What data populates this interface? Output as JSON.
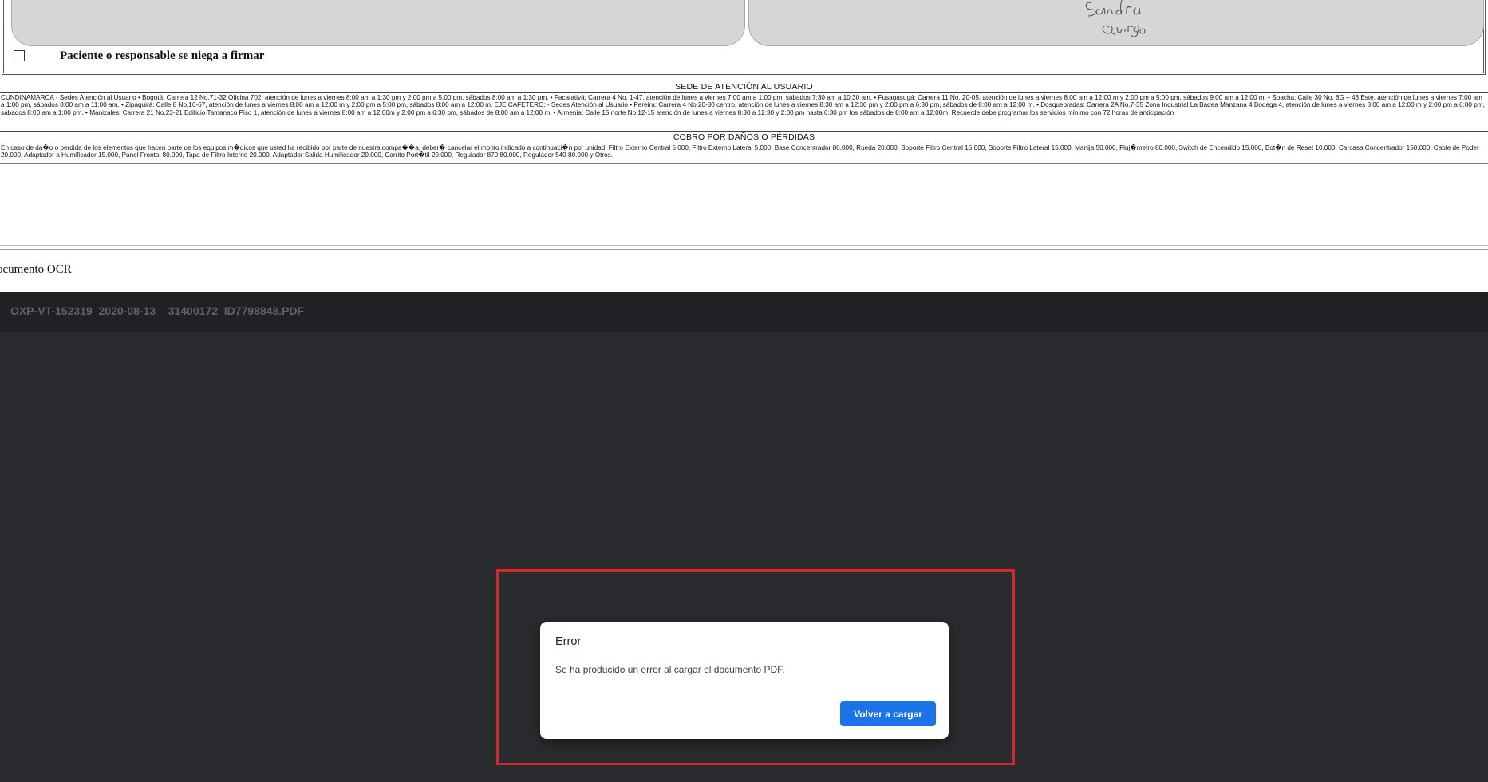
{
  "document": {
    "refuse_to_sign_label": "Paciente o responsable se niega a firmar",
    "signature_text": "Sandra Quiroga",
    "section_user_service": {
      "heading": "SEDE DE ATENCIÓN AL USUARIO",
      "text": "CUNDINAMARCA - Sedes Atención al Usuario • Bogotá: Carrera 12 No.71-32 Oficina 702, atención de lunes a viernes 8:00 am a 1:30 pm y 2:00 pm a 5:00 pm, sábados 8:00 am a 1:30 pm. • Facatativá: Carrera 4 No. 1-47, atención de lunes a viernes 7:00 am a 1:00 pm, sábados 7:30 am a 10:30 am. • Fusagasugá: Carrera 11 No. 20-05, atención de lunes a viernes 8:00 am a 12:00 m y 2:00 pm a 5:00 pm, sábados 9:00 am a 12:00 m. • Soacha: Calle 30 No. 6G – 43 Este, atención de lunes a viernes 7:00 am a 1:00 pm, sábados 8:00 am a 11:00 am. • Zipaquirá: Calle 8 No.16-67, atención de lunes a viernes 8:00 am a 12:00 m y 2:00 pm a 5:00 pm, sábados 8:00 am a 12:00 m. EJE CAFETERO: - Sedes Atención al Usuario • Pereira: Carrera 4 No.20-80 centro, atención de lunes a viernes 8:30 am a 12:30 pm y 2:00 pm a 6:30 pm, sábados de 8:00 am a 12:00 m. • Dosquebradas: Carrera 2A No.7-35 Zona Industrial La Badea Manzana 4 Bodega 4, atención de lunes a viernes 8:00 am a 12:00 m y 2:00 pm a 6:00 pm, sábados 8:00 am a 1:00 pm. • Manizales: Carrera 21 No.23-21 Edificio Tamanaco Piso 1, atención de lunes a viernes 8:00 am a 12:00m y 2:00 pm a 6:30 pm, sábados de 8:00 am a 12:00 m. • Armenia: Calle 15 norte No.12-15 atención de lunes a viernes 8:30 a 12:30 y 2:00 pm hasta 6:30 pm los sábados de 8:00 am a 12:00m. Recuerde debe programar los servicios mínimo con 72 horas de anticipación"
    },
    "section_damages": {
      "heading": "COBRO POR DAÑOS O PÉRDIDAS",
      "text": "En caso de da�o o perdida de los elementos que hacen parte de los equipos m�dicos que usted ha recibido por parte de nuestra compa��a, deber� cancelar el monto indicado a continuaci�n por unidad: Filtro Externo Central 5.000, Filtro Externo Lateral 5.000, Base Concentrador 80.000, Rueda 20.000, Soporte Filtro Central 15.000, Soporte Filtro Lateral 15.000, Manija 50.000, Fluj�metro 80.000, Switch de Encendido 15.000, Bot�n de Reset 10.000, Carcasa Concentrador 150.000, Cable de Poder 20.000, Adaptador a Humificador 15.000, Panel Frontal 80.000, Tapa de Filtro Interno 20.000, Adaptador Salida Humificador 20.000, Carrito Port�til 20.000, Regulador 870 80.000, Regulador 540 80.000 y Otros."
    },
    "ocr_label": "ocumento OCR"
  },
  "viewer": {
    "filename": "OXP-VT-152319_2020-08-13__31400172_ID7798848.PDF"
  },
  "dialog": {
    "title": "Error",
    "message": "Se ha producido un error al cargar el documento PDF.",
    "reload_label": "Volver a cargar"
  },
  "colors": {
    "viewer_bg": "#2a2b2e",
    "toolbar_bg": "#202124",
    "button_blue": "#1a73e8",
    "highlight_red": "#d6262b"
  }
}
